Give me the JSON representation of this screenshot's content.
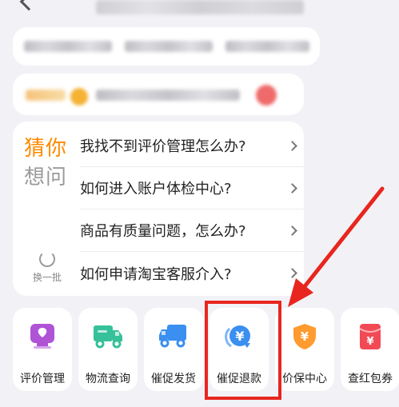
{
  "faq": {
    "title_line1": "猜你",
    "title_line2": "想问",
    "refresh_label": "换一批",
    "questions": [
      "我找不到评价管理怎么办?",
      "如何进入账户体检中心?",
      "商品有质量问题，怎么办?",
      "如何申请淘宝客服介入?"
    ]
  },
  "services": [
    {
      "label": "评价管理",
      "icon": "review-icon",
      "color": "#b054d6"
    },
    {
      "label": "物流查询",
      "icon": "truck-icon",
      "color": "#37c19a"
    },
    {
      "label": "催促发货",
      "icon": "delivery-truck-icon",
      "color": "#3a8ff0"
    },
    {
      "label": "催促退款",
      "icon": "refund-icon",
      "color": "#3a8ff0"
    },
    {
      "label": "价保中心",
      "icon": "price-shield-icon",
      "color": "#ff9b2f"
    },
    {
      "label": "查红包券",
      "icon": "red-envelope-icon",
      "color": "#f24a55"
    }
  ],
  "colors": {
    "accent": "#ff8a00",
    "highlight": "#e8261f"
  }
}
